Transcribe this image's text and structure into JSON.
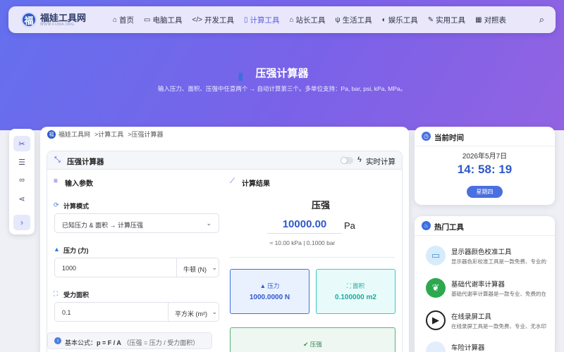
{
  "site": {
    "name": "福娃工具网",
    "url": "WWW.FUWA.ORG",
    "logo_char": "福"
  },
  "nav": [
    {
      "icon": "home-icon",
      "glyph": "⌂",
      "label": "首页"
    },
    {
      "icon": "computer-icon",
      "glyph": "▭",
      "label": "电脑工具"
    },
    {
      "icon": "code-icon",
      "glyph": "</>",
      "label": "开发工具"
    },
    {
      "icon": "calculator-icon",
      "glyph": "▯",
      "label": "计算工具",
      "active": true
    },
    {
      "icon": "store-icon",
      "glyph": "⌂",
      "label": "站长工具"
    },
    {
      "icon": "utensils-icon",
      "glyph": "ψ",
      "label": "生活工具"
    },
    {
      "icon": "gamepad-icon",
      "glyph": "◐",
      "label": "娱乐工具"
    },
    {
      "icon": "wrench-icon",
      "glyph": "✎",
      "label": "实用工具"
    },
    {
      "icon": "table-icon",
      "glyph": "▦",
      "label": "对照表"
    }
  ],
  "hero": {
    "title": "压强计算器",
    "subtitle": "输入压力、面积、压强中任意两个 → 自动计算第三个。多单位支持：Pa, bar, psi, kPa, MPa。"
  },
  "breadcrumb": {
    "home": "福娃工具网",
    "section": ">计算工具",
    "current": ">压强计算器"
  },
  "calculator": {
    "title": "压强计算器",
    "realtime_label": "实时计算",
    "input_section": "输入参数",
    "result_section": "计算结果",
    "mode_label": "计算模式",
    "mode_value": "已知压力 & 面积 → 计算压强",
    "force_label": "压力 (力)",
    "force_value": "1000",
    "force_unit": "牛顿 (N)",
    "area_label": "受力面积",
    "area_value": "0.1",
    "area_unit": "平方米 (m²)",
    "formula_prefix": "基本公式：",
    "formula_bold": "p = F / A",
    "formula_note": "（压强 = 压力 / 受力面积）",
    "result_title": "压强",
    "result_value": "10000.00",
    "result_unit": "Pa",
    "result_equiv": "≈ 10.00 kPa | 0.1000 bar",
    "cards": [
      {
        "label": "压力",
        "value": "1000.0000 N"
      },
      {
        "label": "面积",
        "value": "0.100000 m2"
      },
      {
        "label": "压强",
        "value": ""
      }
    ],
    "colors": {
      "accent": "#5a5fe0",
      "force_card": "#eaf1fe",
      "area_card": "#e8fbfa",
      "pressure_card": "#eef7f1"
    }
  },
  "time_widget": {
    "title": "当前时间",
    "date": "2026年5月7日",
    "time": "14: 58: 19",
    "weekday": "星期四"
  },
  "hot_tools": {
    "title": "热门工具",
    "items": [
      {
        "name": "显示器颜色校准工具",
        "desc": "显示器色彩校准工具是一款免费、专业的",
        "icon": "monitor-icon"
      },
      {
        "name": "基础代谢率计算器",
        "desc": "基础代谢率计算器是一款专业、免费的在",
        "icon": "leaf-icon"
      },
      {
        "name": "在线录屏工具",
        "desc": "在线录屏工具是一款免费、专业、无水印",
        "icon": "screen-record-icon"
      },
      {
        "name": "车险计算器",
        "desc": "",
        "icon": "car-icon"
      }
    ]
  }
}
